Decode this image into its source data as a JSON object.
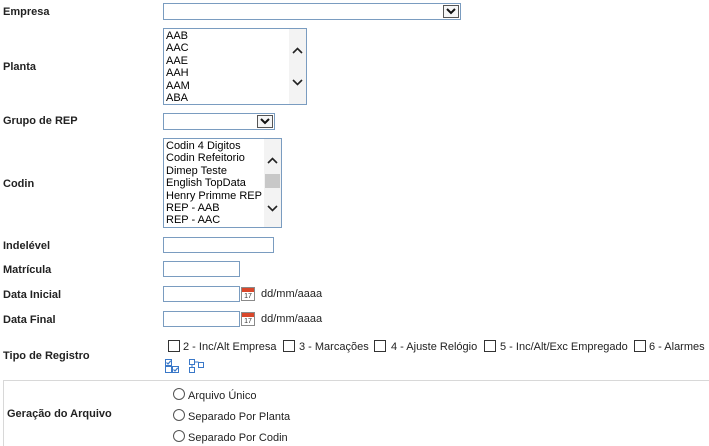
{
  "labels": {
    "empresa": "Empresa",
    "planta": "Planta",
    "grupo_rep": "Grupo de REP",
    "codin": "Codin",
    "indelevel": "Indelével",
    "matricula": "Matrícula",
    "data_inicial": "Data Inicial",
    "data_final": "Data Final",
    "tipo_registro": "Tipo de Registro",
    "geracao": "Geração do Arquivo"
  },
  "empresa_select": {
    "value": ""
  },
  "grupo_rep_select": {
    "value": ""
  },
  "planta_list": {
    "items": [
      "AAB",
      "AAC",
      "AAE",
      "AAH",
      "AAM",
      "ABA"
    ]
  },
  "codin_list": {
    "items": [
      "Codin 4 Digitos",
      "Codin Refeitorio",
      "Dimep Teste",
      "English TopData",
      "Henry Primme REP",
      "REP - AAB",
      "REP - AAC"
    ]
  },
  "inputs": {
    "indelevel": "",
    "matricula": "",
    "data_inicial": "",
    "data_final": ""
  },
  "date_format_hint": "dd/mm/aaaa",
  "calendar_icon": {
    "name": "calendar-icon",
    "day": "17",
    "accent": "#d9472b"
  },
  "tipo_registro_options": [
    {
      "label": "2 - Inc/Alt Empresa",
      "checked": false
    },
    {
      "label": "3 - Marcações",
      "checked": false
    },
    {
      "label": "4 - Ajuste Relógio",
      "checked": false
    },
    {
      "label": "5 - Inc/Alt/Exc Empregado",
      "checked": false
    },
    {
      "label": "6 - Alarmes",
      "checked": false
    }
  ],
  "tools": [
    "check-all-icon",
    "tree-expand-icon"
  ],
  "geracao_options": [
    {
      "label": "Arquivo Único",
      "selected": false
    },
    {
      "label": "Separado Por Planta",
      "selected": false
    },
    {
      "label": "Separado Por Codin",
      "selected": false
    }
  ],
  "colors": {
    "border": "#7a9cc0",
    "icon_blue": "#3a78c8"
  }
}
